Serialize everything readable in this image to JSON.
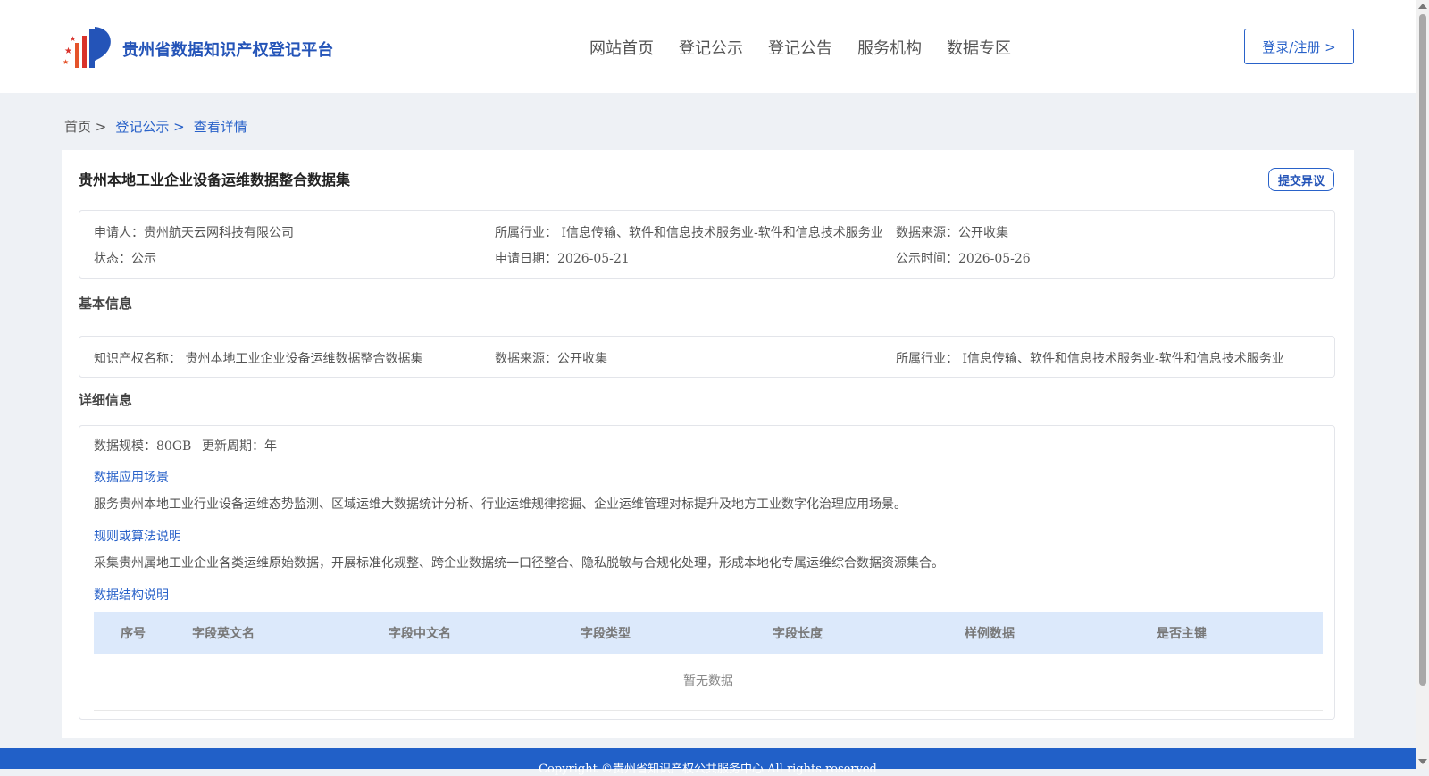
{
  "header": {
    "site_title": "贵州省数据知识产权登记平台",
    "nav": [
      "网站首页",
      "登记公示",
      "登记公告",
      "服务机构",
      "数据专区"
    ],
    "login_label": "登录/注册 >"
  },
  "breadcrumb": {
    "home": "首页 >",
    "level1": "登记公示 >",
    "level2": "查看详情"
  },
  "detail": {
    "title": "贵州本地工业企业设备运维数据整合数据集",
    "objection_label": "提交异议",
    "summary": {
      "applicant": "申请人：贵州航天云网科技有限公司",
      "industry": "所属行业： I信息传输、软件和信息技术服务业-软件和信息技术服务业",
      "source": "数据来源：公开收集",
      "status": "状态：公示",
      "apply_date": "申请日期：2026-05-21",
      "publish_time": "公示时间：2026-05-26"
    },
    "basic_title": "基本信息",
    "basic": {
      "ip_name": "知识产权名称： 贵州本地工业企业设备运维数据整合数据集",
      "source": "数据来源：公开收集",
      "industry": "所属行业： I信息传输、软件和信息技术服务业-软件和信息技术服务业"
    },
    "detail_title": "详细信息",
    "scale": "数据规模：80GB",
    "update_cycle": "更新周期：年",
    "scenario_title": "数据应用场景",
    "scenario_text": "服务贵州本地工业行业设备运维态势监测、区域运维大数据统计分析、行业运维规律挖掘、企业运维管理对标提升及地方工业数字化治理应用场景。",
    "rules_title": "规则或算法说明",
    "rules_text": "采集贵州属地工业企业各类运维原始数据，开展标准化规整、跨企业数据统一口径整合、隐私脱敏与合规化处理，形成本地化专属运维综合数据资源集合。",
    "structure_title": "数据结构说明",
    "table": {
      "headers": [
        "序号",
        "字段英文名",
        "字段中文名",
        "字段类型",
        "字段长度",
        "样例数据",
        "是否主键"
      ],
      "empty_text": "暂无数据"
    }
  },
  "footer": {
    "copyright": "Copyright ©贵州省知识产权公共服务中心 All rights reserved"
  }
}
